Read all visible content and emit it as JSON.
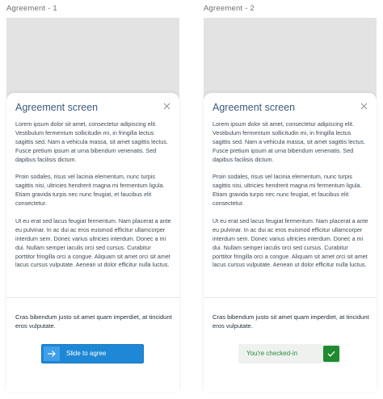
{
  "frames": [
    {
      "label": "Agreement - 1",
      "title": "Agreement screen",
      "paragraphs": [
        "Lorem ipsum dolor sit amet, consectetur adipiscing elit. Vestibulum fermentum sollicitudin mi, in fringilla lectus sagittis sed. Nam a vehicula massa, sit amet sagittis lectus. Fusce pretium ipsum at urna bibendum venenatis. Sed dapibus facilisis dictum.",
        "Proin sodales, risus vel lacinia elementum, nunc turpis sagittis nisi, ultricies hendrerit magna mi fermentum ligula. Etiam gravida turpis nec nunc feugiat, et faucibus elit consectetur.",
        "Ut eu erat sed lacus feugiat fermentum. Nam placerat a ante eu pulvinar. In ac dui ac eros euismod efficitur ullamcorper interdum sem. Donec varius ultricies interdum. Donec a mi dui. Nullam semper iaculis orci sed cursus. Curabitur porttitor fringilla orci a congue. Aliquam sit amet orci sit amet lacus cursus vulputate. Aenean ut dolor efficitur nulla luctus."
      ],
      "footer": "Cras bibendum justo sit amet quam imperdiet, at tincidunt eros vulputate.",
      "slide_label": "Slide to agree"
    },
    {
      "label": "Agreement - 2",
      "title": "Agreement screen",
      "paragraphs": [
        "Lorem ipsum dolor sit amet, consectetur adipiscing elit. Vestibulum fermentum sollicitudin mi, in fringilla lectus sagittis sed. Nam a vehicula massa, sit amet sagittis lectus. Fusce pretium ipsum at urna bibendum venenatis. Sed dapibus facilisis dictum.",
        "Proin sodales, risus vel lacinia elementum, nunc turpis sagittis nisi, ultricies hendrerit magna mi fermentum ligula. Etiam gravida turpis nec nunc feugiat, et faucibus elit consectetur.",
        "Ut eu erat sed lacus feugiat fermentum. Nam placerat a ante eu pulvinar. In ac dui ac eros euismod efficitur ullamcorper interdum sem. Donec varius ultricies interdum. Donec a mi dui. Nullam semper iaculis orci sed cursus. Curabitur porttitor fringilla orci a congue. Aliquam sit amet orci sit amet lacus cursus vulputate. Aenean ut dolor efficitur nulla luctus."
      ],
      "footer": "Cras bibendum justo sit amet quam imperdiet, at tincidunt eros vulputate.",
      "checked_label": "You're checked-in"
    }
  ],
  "icons": {
    "close": "close-icon",
    "arrow": "arrow-right-icon",
    "check": "check-icon"
  },
  "colors": {
    "title": "#3c5a78",
    "slide_button": "#1e88d6",
    "success": "#1f8a2f"
  }
}
